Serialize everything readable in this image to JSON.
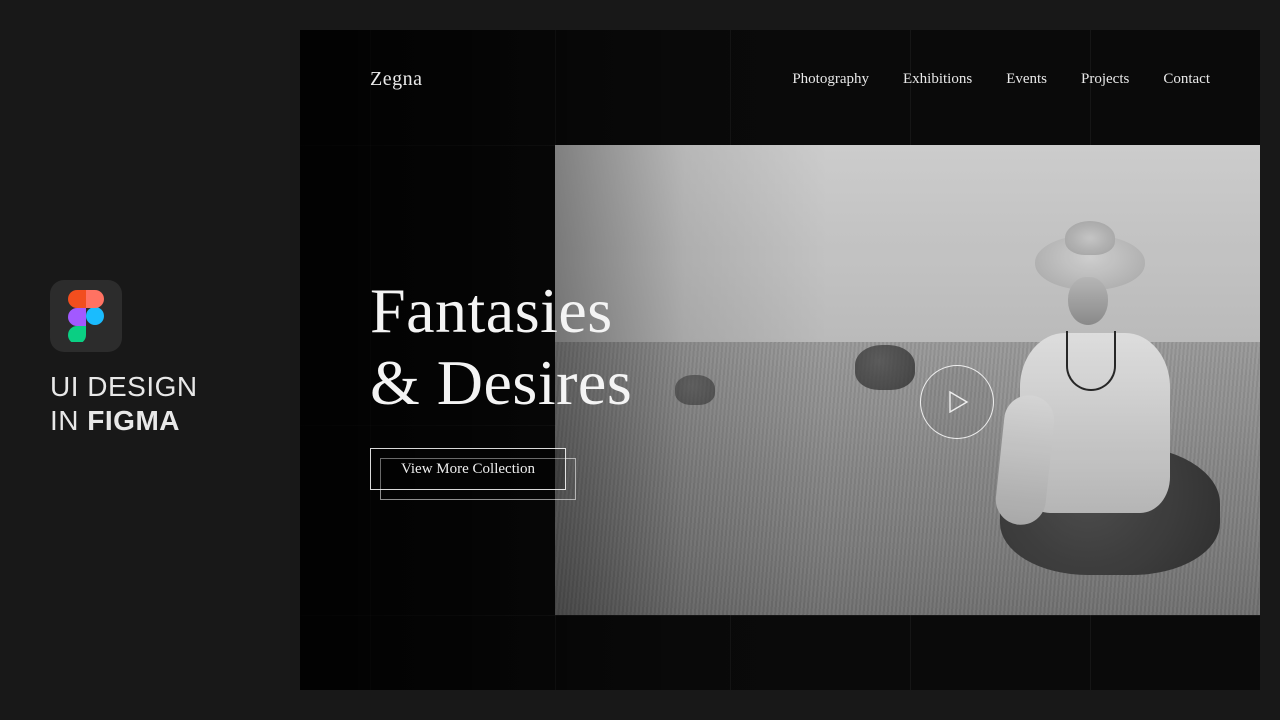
{
  "promo": {
    "line1": "UI DESIGN",
    "line2_prefix": "IN ",
    "line2_bold": "FIGMA"
  },
  "header": {
    "brand": "Zegna",
    "nav": [
      "Photography",
      "Exhibitions",
      "Events",
      "Projects",
      "Contact"
    ]
  },
  "hero": {
    "title_line1": "Fantasies",
    "title_line2": "& Desires",
    "cta_label": "View More Collection"
  },
  "icons": {
    "figma": "figma-icon",
    "play": "play-icon"
  }
}
